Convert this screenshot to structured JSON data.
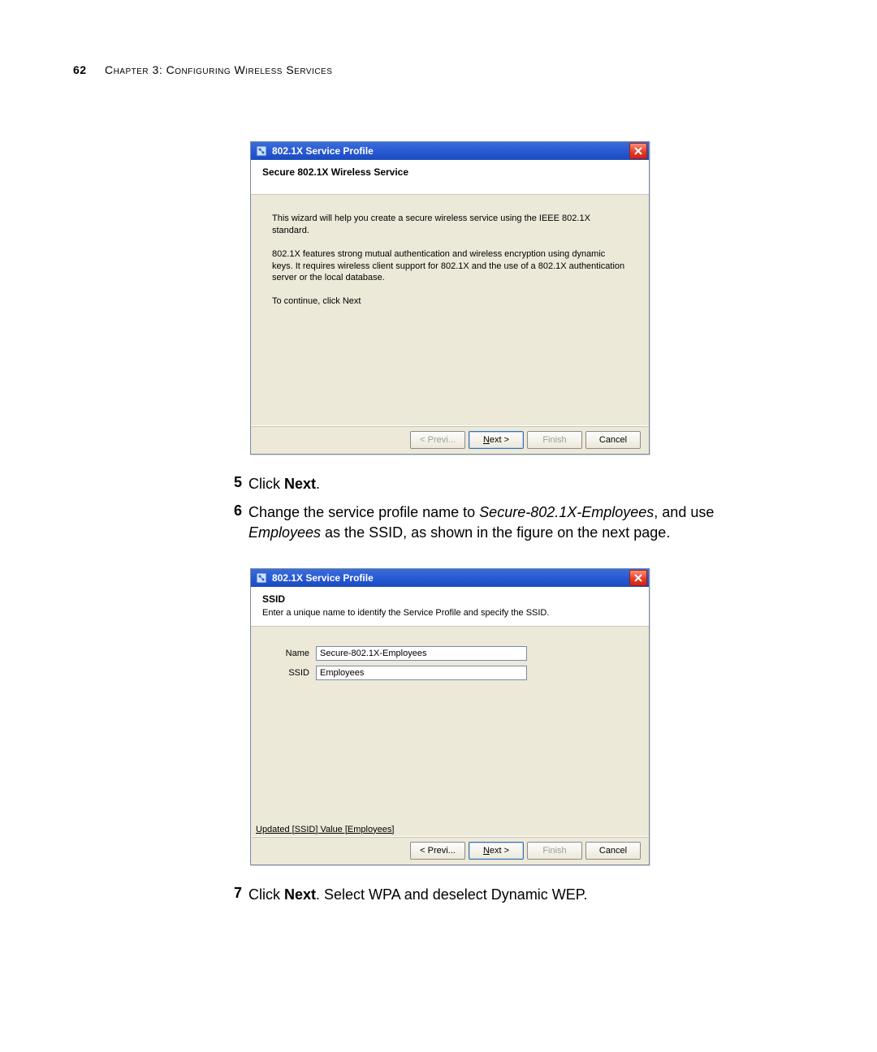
{
  "page": {
    "number": "62",
    "chapter_label": "Chapter 3: Configuring Wireless Services"
  },
  "steps": {
    "s5_num": "5",
    "s5_prefix": "Click ",
    "s5_bold": "Next",
    "s5_suffix": ".",
    "s6_num": "6",
    "s6_a": "Change the service profile name to ",
    "s6_i1": "Secure-802.1X-Employees",
    "s6_b": ", and use ",
    "s6_i2": "Employees",
    "s6_c": " as the SSID, as shown in the figure on the next page.",
    "s7_num": "7",
    "s7_a": "Click ",
    "s7_bold": "Next",
    "s7_b": ". Select WPA and deselect Dynamic WEP."
  },
  "wiz1": {
    "title": "802.1X Service Profile",
    "head": "Secure 802.1X Wireless Service",
    "p1": "This wizard will help you create a secure wireless service using the IEEE 802.1X standard.",
    "p2": "802.1X features strong mutual authentication and wireless encryption using dynamic keys. It requires wireless client support for 802.1X and the use of a 802.1X authentication server or the local database.",
    "p3": "To continue, click Next",
    "buttons": {
      "prev": "< Previ...",
      "next_pfx": "N",
      "next_rest": "ext >",
      "finish": "Finish",
      "cancel": "Cancel"
    }
  },
  "wiz2": {
    "title": "802.1X Service Profile",
    "head": "SSID",
    "sub": "Enter a unique name to identify the Service Profile and specify the SSID.",
    "name_label": "Name",
    "name_value": "Secure-802.1X-Employees",
    "ssid_label": "SSID",
    "ssid_value": "Employees",
    "status": "Updated [SSID] Value [Employees]",
    "buttons": {
      "prev": "< Previ...",
      "next_pfx": "N",
      "next_rest": "ext >",
      "finish": "Finish",
      "cancel": "Cancel"
    }
  }
}
